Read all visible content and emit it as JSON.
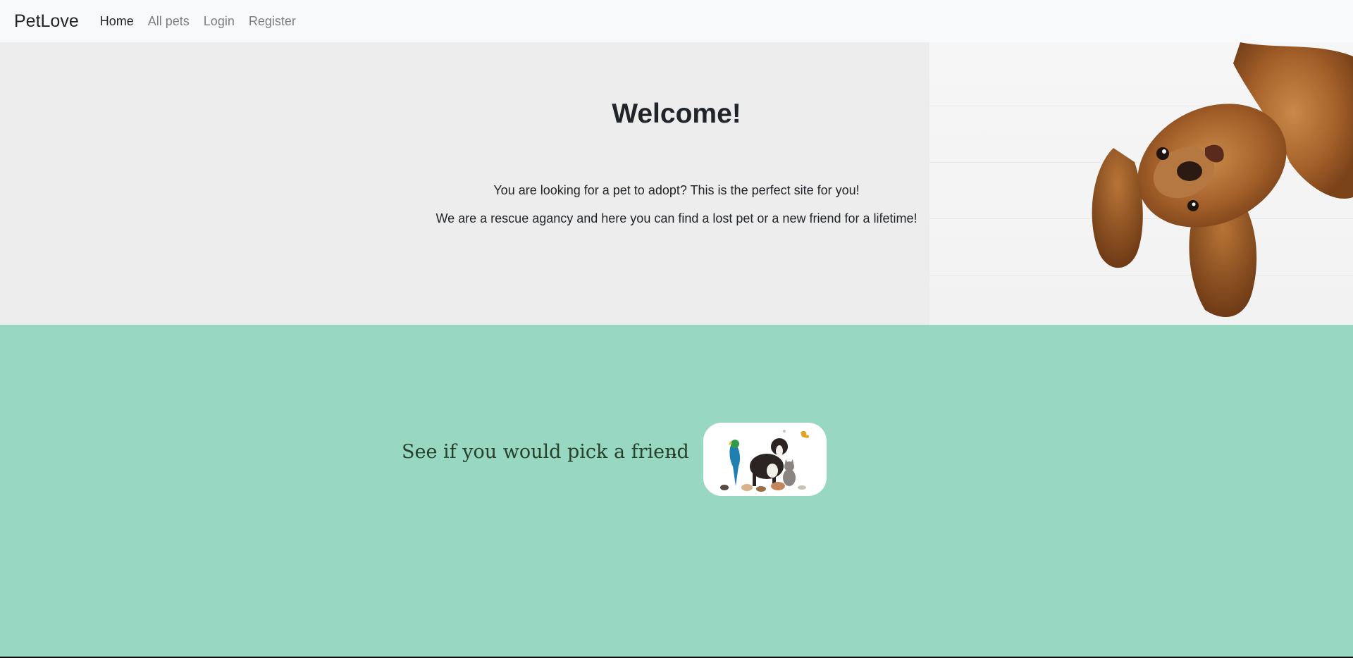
{
  "navbar": {
    "brand": "PetLove",
    "links": [
      {
        "label": "Home",
        "active": true
      },
      {
        "label": "All pets",
        "active": false
      },
      {
        "label": "Login",
        "active": false
      },
      {
        "label": "Register",
        "active": false
      }
    ]
  },
  "hero": {
    "title": "Welcome!",
    "line1": "You are looking for a pet to adopt? This is the perfect site for you!",
    "line2": "We are a rescue agancy and here you can find a lost pet or a new friend for a lifetime!",
    "image": "puppy-dog-image"
  },
  "feature": {
    "cta_text": "See if you would pick a friend",
    "arrow": "→",
    "image": "group-of-pets-image"
  },
  "colors": {
    "navbar_bg": "#f8f9fa",
    "hero_bg": "#ededed",
    "feature_bg": "#98d8c2",
    "cta_text": "#27412b"
  }
}
